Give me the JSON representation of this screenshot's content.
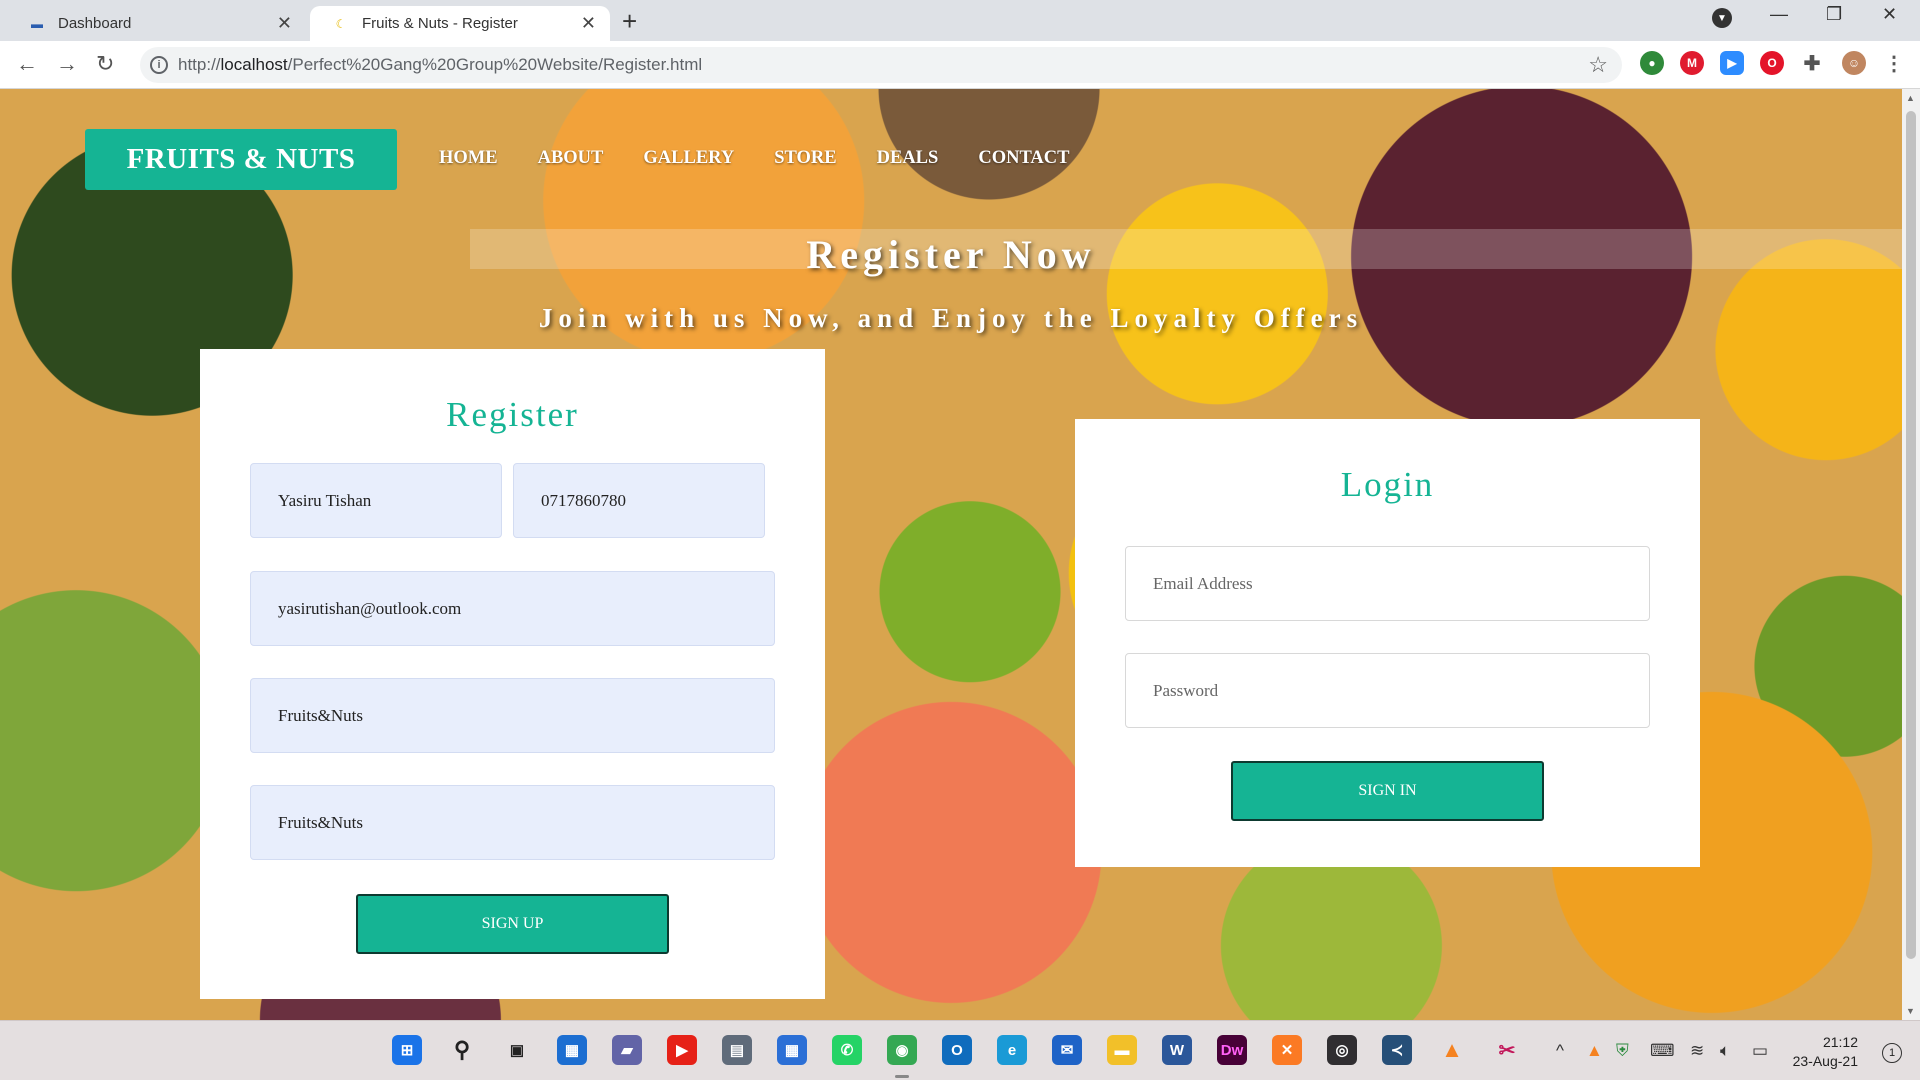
{
  "browser": {
    "tabs": [
      {
        "title": "Dashboard",
        "favicon": "dashboard-favicon"
      },
      {
        "title": "Fruits & Nuts - Register",
        "favicon": "banana-favicon"
      }
    ],
    "url_prefix": "http://",
    "url_host": "localhost",
    "url_path": "/Perfect%20Gang%20Group%20Website/Register.html"
  },
  "site": {
    "brand": "FRUITS & NUTS",
    "nav": [
      "HOME",
      "ABOUT",
      "GALLERY",
      "STORE",
      "DEALS",
      "CONTACT"
    ],
    "hero_title": "Register Now",
    "hero_subtitle": "Join with us Now, and Enjoy the Loyalty Offers"
  },
  "register": {
    "title": "Register",
    "name_value": "Yasiru Tishan",
    "phone_value": "0717860780",
    "email_value": "yasirutishan@outlook.com",
    "password_value": "Fruits&Nuts",
    "confirm_value": "Fruits&Nuts",
    "button": "SIGN UP"
  },
  "login": {
    "title": "Login",
    "email_placeholder": "Email Address",
    "password_placeholder": "Password",
    "button": "SIGN IN"
  },
  "taskbar": {
    "time": "21:12",
    "date": "23-Aug-21",
    "notifications": "1"
  },
  "colors": {
    "accent": "#15b494",
    "filled_field": "#e8eefc"
  }
}
